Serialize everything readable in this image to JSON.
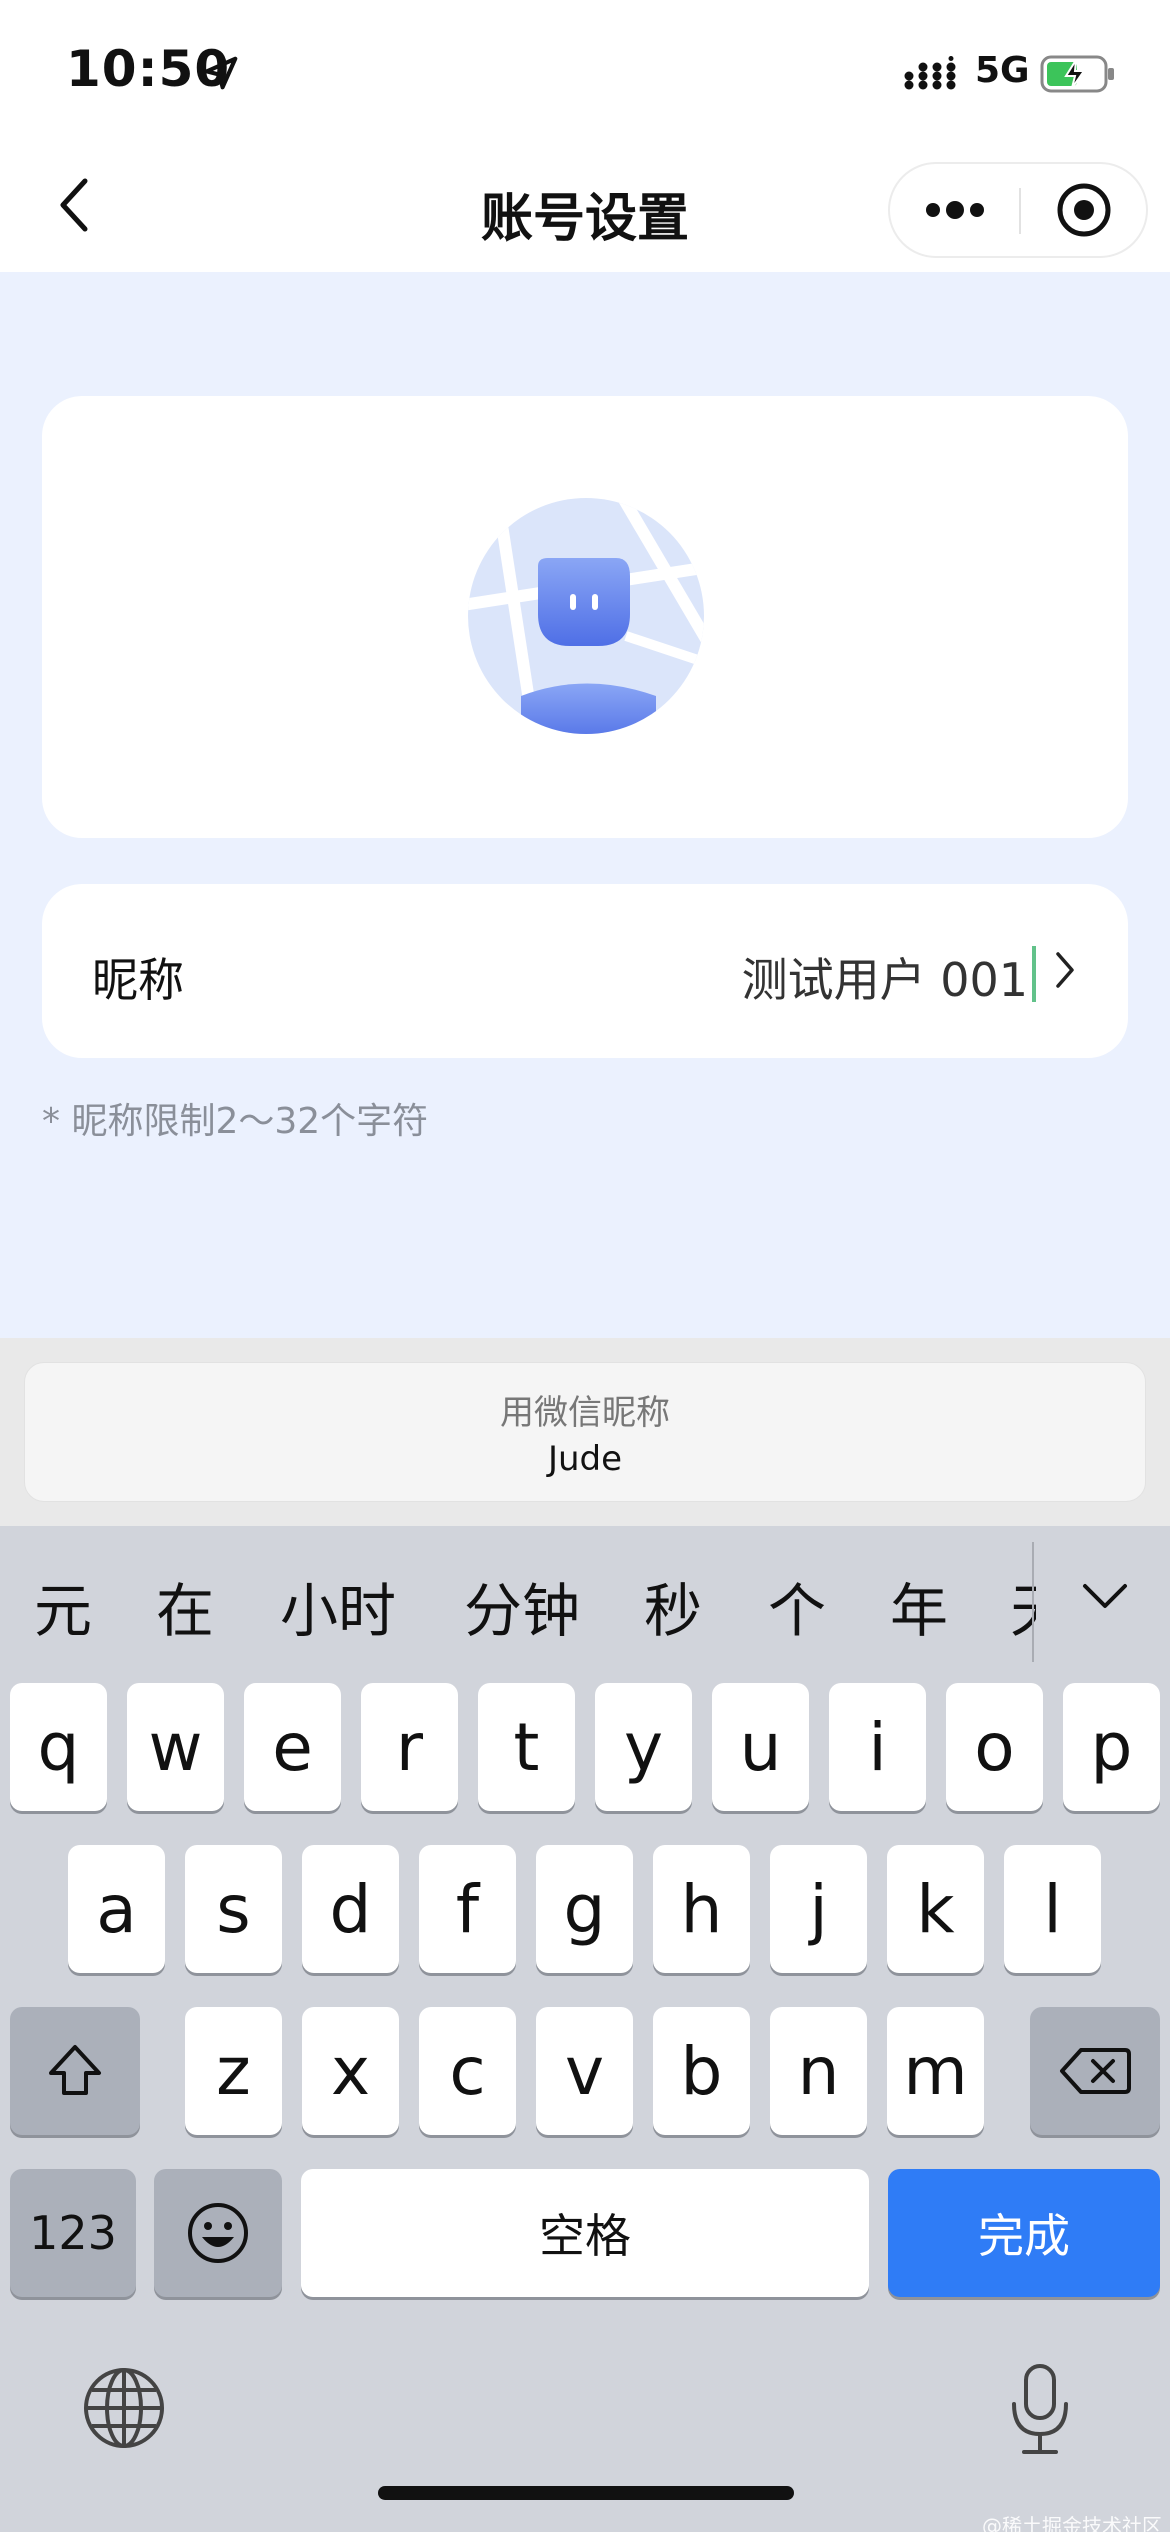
{
  "status_bar": {
    "time": "10:50",
    "network": "5G"
  },
  "nav": {
    "title": "账号设置"
  },
  "profile": {
    "nickname_label": "昵称",
    "nickname_value": "测试用户 001",
    "hint": "* 昵称限制2～32个字符"
  },
  "suggestion": {
    "title": "用微信昵称",
    "name": "Jude"
  },
  "keyboard": {
    "candidates": [
      "元",
      "在",
      "小时",
      "分钟",
      "秒",
      "个",
      "年"
    ],
    "candidate_partial": "天",
    "row1": [
      "q",
      "w",
      "e",
      "r",
      "t",
      "y",
      "u",
      "i",
      "o",
      "p"
    ],
    "row2": [
      "a",
      "s",
      "d",
      "f",
      "g",
      "h",
      "j",
      "k",
      "l"
    ],
    "row3": [
      "z",
      "x",
      "c",
      "v",
      "b",
      "n",
      "m"
    ],
    "numbers_label": "123",
    "space_label": "空格",
    "done_label": "完成"
  },
  "watermark": "@稀土掘金技术社区",
  "colors": {
    "accent": "#2f7cf6",
    "page_bg": "#ebf1fe",
    "keyboard_bg": "#d1d4db"
  },
  "icons": [
    "location-arrow-icon",
    "signal-icon",
    "battery-charging-icon",
    "back-chevron-icon",
    "more-dots-icon",
    "close-target-icon",
    "avatar-image",
    "chevron-right-icon",
    "chevron-down-icon",
    "shift-icon",
    "backspace-icon",
    "emoji-icon",
    "globe-icon",
    "mic-icon"
  ]
}
